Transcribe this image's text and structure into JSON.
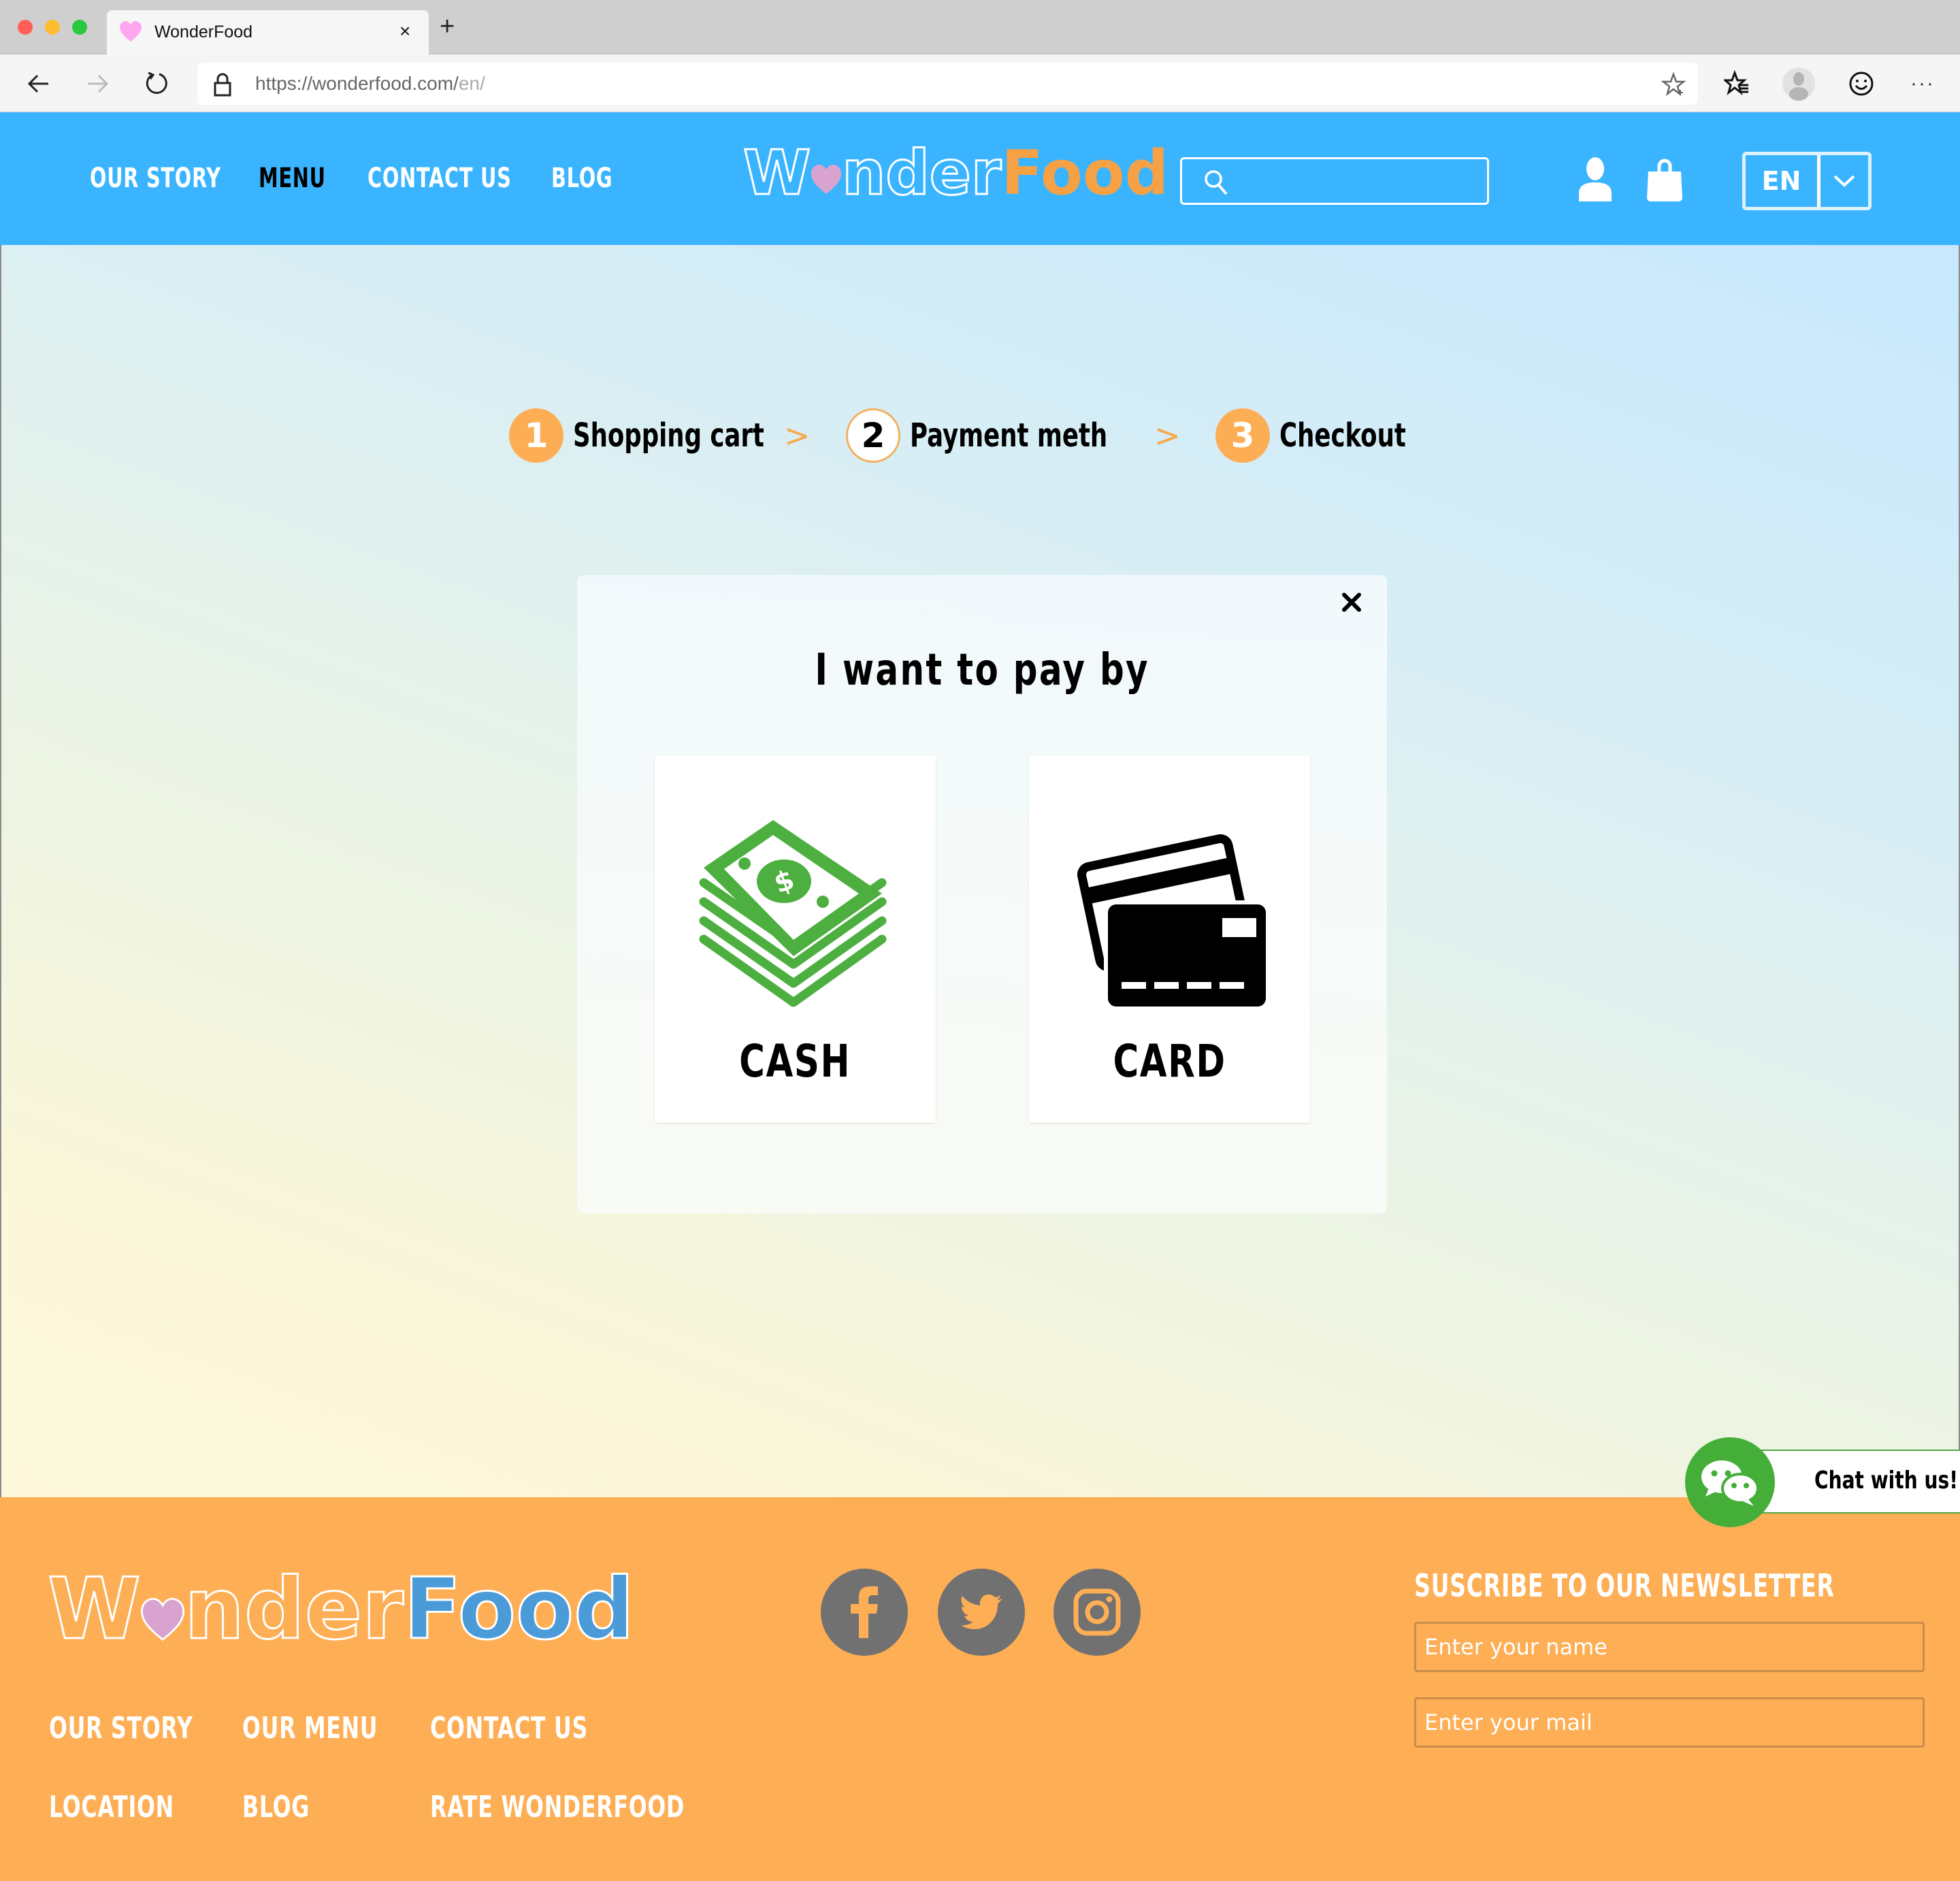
{
  "browser": {
    "tab_title": "WonderFood",
    "tab_favicon": "pink-heart-icon",
    "tab_close_label": "×",
    "new_tab_label": "+",
    "url_main": "https://wonderfood.com/",
    "url_path": "en/",
    "more_label": "···",
    "icons": [
      "back-arrow-icon",
      "forward-arrow-icon",
      "reload-icon",
      "lock-icon",
      "add-favorite-star-icon",
      "favorites-icon",
      "profile-icon",
      "emoji-feedback-icon",
      "more-icon"
    ]
  },
  "header": {
    "nav": [
      {
        "label": "OUR STORY",
        "active": false
      },
      {
        "label": "MENU",
        "active": true
      },
      {
        "label": "CONTACT US",
        "active": false
      },
      {
        "label": "BLOG",
        "active": false
      }
    ],
    "logo": {
      "part1_prefix": "W",
      "part1_suffix": "nder",
      "part2": "Food"
    },
    "search": {
      "placeholder": "",
      "value": ""
    },
    "icons": [
      "user-icon",
      "shopping-bag-icon"
    ],
    "language": {
      "selected": "EN"
    }
  },
  "checkout_steps": [
    {
      "number": "1",
      "label": "Shopping cart",
      "state": "done"
    },
    {
      "number": "2",
      "label": "Payment meth",
      "state": "current"
    },
    {
      "number": "3",
      "label": "Checkout",
      "state": "pending"
    }
  ],
  "step_separator": ">",
  "modal": {
    "title": "I want to pay by",
    "close_label": "×",
    "options": [
      {
        "label": "CASH",
        "icon": "cash-stack-icon"
      },
      {
        "label": "CARD",
        "icon": "credit-cards-icon"
      }
    ]
  },
  "chat": {
    "label": "Chat with us!",
    "icon": "wechat-bubbles-icon"
  },
  "footer": {
    "logo": {
      "part1_prefix": "W",
      "part1_suffix": "nder",
      "part2": "Food"
    },
    "links": [
      [
        "OUR STORY",
        "OUR MENU",
        "CONTACT US"
      ],
      [
        "LOCATION",
        "BLOG",
        "RATE WONDERFOOD"
      ]
    ],
    "social": [
      "facebook-icon",
      "twitter-icon",
      "instagram-icon"
    ],
    "newsletter": {
      "title": "SUSCRIBE TO OUR NEWSLETTER",
      "name_placeholder": "Enter your name",
      "mail_placeholder": "Enter your mail"
    }
  },
  "colors": {
    "header_blue": "#3BB4FF",
    "accent_orange": "#FDAE55",
    "logo_orange": "#F7A145",
    "footer_logo_blue": "#4A9BD8",
    "heart_pink": "#D9A3CF",
    "cash_green": "#4CAF3F",
    "chat_green": "#44AE38",
    "social_gray": "#717171"
  }
}
